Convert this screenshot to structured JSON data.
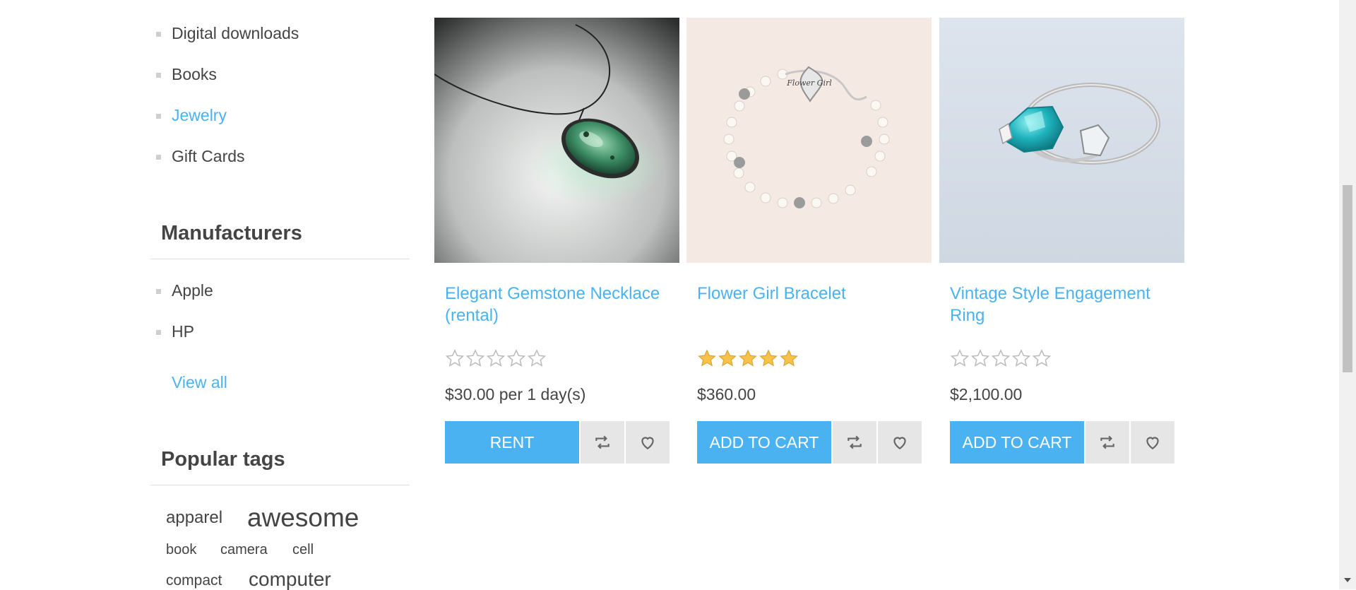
{
  "categories": {
    "items": [
      {
        "label": "Digital downloads",
        "active": false
      },
      {
        "label": "Books",
        "active": false
      },
      {
        "label": "Jewelry",
        "active": true
      },
      {
        "label": "Gift Cards",
        "active": false
      }
    ]
  },
  "manufacturers": {
    "title": "Manufacturers",
    "items": [
      {
        "label": "Apple"
      },
      {
        "label": "HP"
      }
    ],
    "view_all": "View all"
  },
  "popular_tags": {
    "title": "Popular tags",
    "tags": [
      "apparel",
      "awesome",
      "book",
      "camera",
      "cell",
      "compact",
      "computer"
    ]
  },
  "products": [
    {
      "title": "Elegant Gemstone Necklace (rental)",
      "rating_stars": 0,
      "price": "$30.00 per 1 day(s)",
      "button_label": "RENT",
      "image_icon": "necklace-image"
    },
    {
      "title": "Flower Girl Bracelet",
      "rating_stars": 5,
      "price": "$360.00",
      "button_label": "ADD TO CART",
      "image_icon": "bracelet-image",
      "charm_text": "Flower Girl"
    },
    {
      "title": "Vintage Style Engagement Ring",
      "rating_stars": 0,
      "price": "$2,100.00",
      "button_label": "ADD TO CART",
      "image_icon": "ring-image"
    }
  ],
  "colors": {
    "accent": "#4ab2f1",
    "star_filled": "#f6c24a",
    "star_empty": "#bbbbbb",
    "icon_button_bg": "#e6e6e6"
  }
}
